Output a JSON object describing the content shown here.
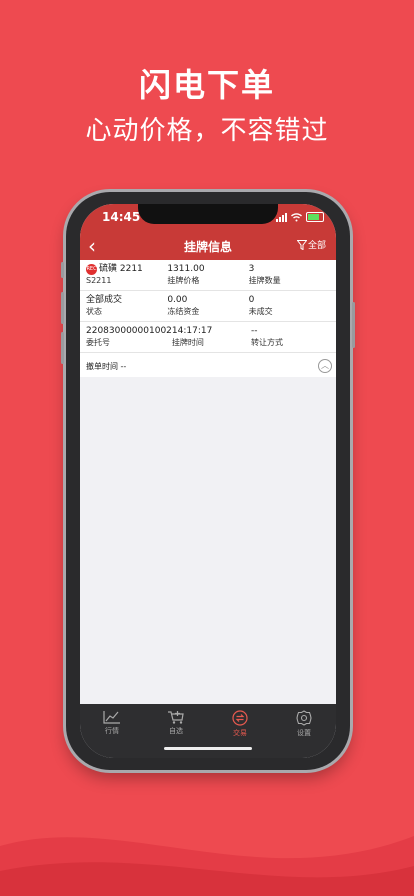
{
  "promo": {
    "title": "闪电下单",
    "subtitle": "心动价格，不容错过"
  },
  "status": {
    "time": "14:45"
  },
  "nav": {
    "back": "‹",
    "title": "挂牌信息",
    "filter_label": "全部"
  },
  "rows": [
    [
      {
        "badge": "REC",
        "value": "硫磺 2211",
        "label": "S2211"
      },
      {
        "value": "1311.00",
        "label": "挂牌价格"
      },
      {
        "value": "3",
        "label": "挂牌数量"
      }
    ],
    [
      {
        "value": "全部成交",
        "label": "状态"
      },
      {
        "value": "0.00",
        "label": "冻结资金"
      },
      {
        "value": "0",
        "label": "未成交"
      }
    ],
    [
      {
        "value": "220830000001002",
        "label": "委托号"
      },
      {
        "value": "14:17:17",
        "label": "挂牌时间"
      },
      {
        "value": "--",
        "label": "转让方式"
      }
    ]
  ],
  "cancel_time": "撤单时间 --",
  "tabs": [
    {
      "label": "行情",
      "icon": "chart-icon"
    },
    {
      "label": "自选",
      "icon": "cart-icon"
    },
    {
      "label": "交易",
      "icon": "exchange-icon",
      "active": true
    },
    {
      "label": "设置",
      "icon": "gear-icon"
    }
  ],
  "colors": {
    "background": "#ee4a50",
    "header": "#c83a37",
    "active_tab": "#e85a4f"
  }
}
